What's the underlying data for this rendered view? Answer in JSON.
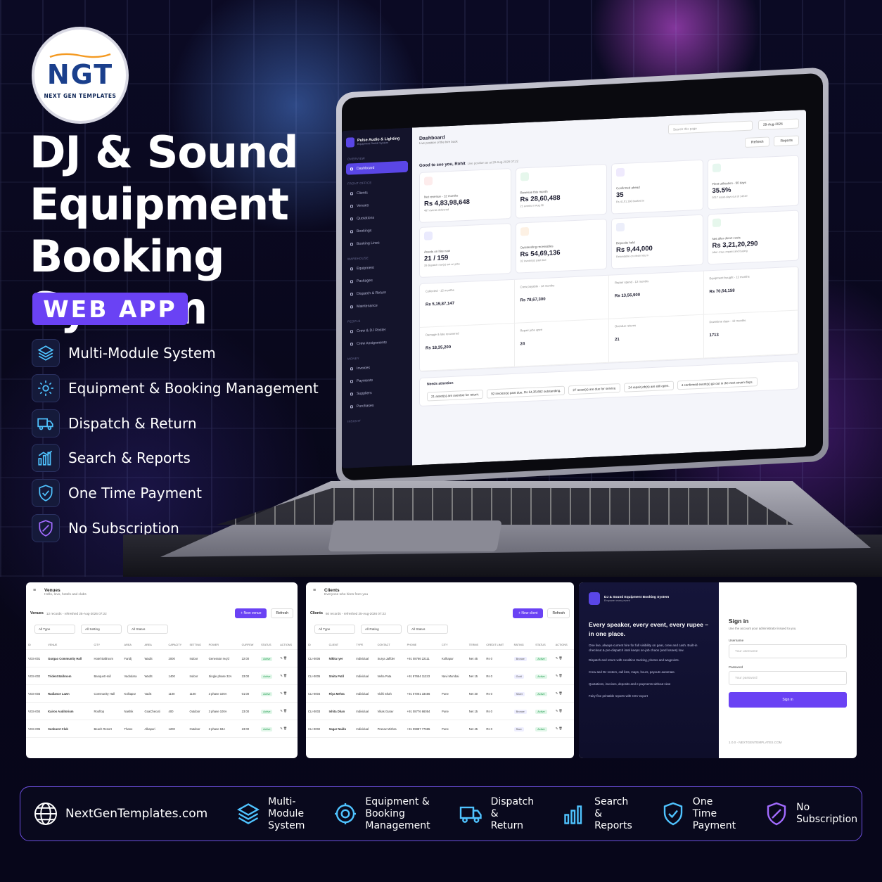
{
  "brand": {
    "logo_mark": "NGT",
    "logo_text": "NEXT GEN TEMPLATES"
  },
  "hero": {
    "title_line1": "DJ & Sound",
    "title_line2": "Equipment",
    "title_line3": "Booking System",
    "badge": "WEB APP"
  },
  "features": [
    {
      "label": "Multi-Module System",
      "icon": "layers-icon"
    },
    {
      "label": "Equipment & Booking Management",
      "icon": "gear-icon"
    },
    {
      "label": "Dispatch & Return",
      "icon": "truck-icon"
    },
    {
      "label": "Search & Reports",
      "icon": "bar-chart-icon"
    },
    {
      "label": "One Time Payment",
      "icon": "shield-check-icon"
    },
    {
      "label": "No Subscription",
      "icon": "shield-no-icon"
    }
  ],
  "dashboard": {
    "sidebar": {
      "brand_name": "Pulse Audio & Lighting",
      "brand_sub": "Equipment Rental System",
      "sections": [
        {
          "title": "OVERVIEW",
          "items": [
            "Dashboard"
          ]
        },
        {
          "title": "FRONT OFFICE",
          "items": [
            "Clients",
            "Venues",
            "Quotations",
            "Bookings",
            "Booking Lines"
          ]
        },
        {
          "title": "WAREHOUSE",
          "items": [
            "Equipment",
            "Packages",
            "Dispatch & Return",
            "Maintenance"
          ]
        },
        {
          "title": "PEOPLE",
          "items": [
            "Crew & DJ Roster",
            "Crew Assignments"
          ]
        },
        {
          "title": "MONEY",
          "items": [
            "Invoices",
            "Payments",
            "Suppliers",
            "Purchases"
          ]
        },
        {
          "title": "INSIGHT",
          "items": []
        }
      ]
    },
    "title": "Dashboard",
    "subtitle": "Live position of the hire book",
    "search_placeholder": "Search this page",
    "date": "29-Aug-2026",
    "refresh": "Refresh",
    "reports": "Reports",
    "greeting": "Good to see you, Rohit",
    "greeting_note": "Live position as at 29-Aug-2026 07:22",
    "kpis": [
      {
        "label": "Net revenue - 12 months",
        "value": "Rs 4,83,98,648",
        "note": "487 events delivered",
        "color": "#fdecec"
      },
      {
        "label": "Revenue this month",
        "value": "Rs 28,60,488",
        "note": "21 events in Aug 26",
        "color": "#e6f7ec"
      },
      {
        "label": "Confirmed ahead",
        "value": "35",
        "note": "Rs 41,01,198 booked in",
        "color": "#efeafd"
      },
      {
        "label": "Fleet utilisation - 90 days",
        "value": "35.5%",
        "note": "5017 asset-days out of 14310",
        "color": "#e6f7ef"
      },
      {
        "label": "Assets on hire now",
        "value": "21 / 159",
        "note": "28 dispatch row(s) out on jobs",
        "color": "#eaeafd"
      },
      {
        "label": "Outstanding receivables",
        "value": "Rs 54,69,136",
        "note": "32 invoice(s) past due",
        "color": "#fdf1e4"
      },
      {
        "label": "Deposits held",
        "value": "Rs 9,44,000",
        "note": "Refundable on clean return",
        "color": "#eceefa"
      },
      {
        "label": "Net after direct costs",
        "value": "Rs 3,21,20,290",
        "note": "After crew, repairs and buying",
        "color": "#e6f7ec"
      }
    ],
    "stats": [
      {
        "label": "Collected - 12 months",
        "value": "Rs 5,19,87,147"
      },
      {
        "label": "Crew payable - 12 months",
        "value": "Rs 78,67,300"
      },
      {
        "label": "Repair spend - 12 months",
        "value": "Rs 13,56,900"
      },
      {
        "label": "Equipment bought - 12 months",
        "value": "Rs 70,54,158"
      },
      {
        "label": "Damage & late recovered",
        "value": "Rs 18,35,200"
      },
      {
        "label": "Repair jobs open",
        "value": "24"
      },
      {
        "label": "Overdue returns",
        "value": "21"
      },
      {
        "label": "Downtime days - 12 months",
        "value": "1713"
      }
    ],
    "attention_title": "Needs attention",
    "attention": [
      "21 asset(s) are overdue for return.",
      "92 invoice(s) past due, Rs 54,35,662 outstanding.",
      "27 asset(s) are due for service.",
      "24 repair job(s) are still open.",
      "4 confirmed event(s) go out in the next seven days."
    ]
  },
  "venues": {
    "title": "Venues",
    "subtitle": "Hello, lovo, hotels and clubs",
    "bar_title": "Venues",
    "bar_note": "12 records - refreshed 25-Aug-2026 07:22",
    "new_label": "+ New venue",
    "refresh": "Refresh",
    "filters": [
      "All Type",
      "All Setting",
      "All Status"
    ],
    "columns": [
      "ID",
      "VENUE",
      "CITY",
      "AREA",
      "AREA",
      "CAPACITY",
      "SETTING",
      "POWER",
      "CURFEW",
      "STATUS",
      "ACTIONS"
    ],
    "rows": [
      [
        "VGS-001",
        "Gurgao Community Hall",
        "Hotel Ballroom",
        "Faridj",
        "WadS",
        "2000",
        "Indoor",
        "Generator req'd",
        "22:00",
        "Active"
      ],
      [
        "VGS-002",
        "Trident Ballroom",
        "Banquet Hall",
        "Vadodara",
        "WadS",
        "1400",
        "Indoor",
        "Single phase 32A",
        "23:00",
        "Active"
      ],
      [
        "VGS-003",
        "Radiance Lawn",
        "Community Hall",
        "Kolkapur",
        "VadS",
        "1100",
        "1100",
        "3 phase 100A",
        "01:00",
        "Active"
      ],
      [
        "VGS-004",
        "Kairos Auditorium",
        "Rooftop",
        "Nashik",
        "GoaChecuti",
        "400",
        "Outdoor",
        "3 phase 100A",
        "23:00",
        "Active"
      ],
      [
        "VGS-005",
        "Sunburst Club",
        "Beach Resort",
        "Thane",
        "Alkapuri",
        "1200",
        "Outdoor",
        "3 phase 63A",
        "23:00",
        "Active"
      ]
    ]
  },
  "clients": {
    "title": "Clients",
    "subtitle": "Everyone who hires from you",
    "bar_title": "Clients",
    "bar_note": "60 records - refreshed 25-Aug-2026 07:22",
    "new_label": "+ New client",
    "refresh": "Refresh",
    "filters": [
      "All Type",
      "All Rating",
      "All Status"
    ],
    "columns": [
      "ID",
      "CLIENT",
      "TYPE",
      "CONTACT",
      "PHONE",
      "CITY",
      "TERMS",
      "CREDIT LIMIT",
      "RATING",
      "STATUS",
      "ACTIONS"
    ],
    "rows": [
      [
        "CLI-0006",
        "Nikita Iyer",
        "Individual",
        "Surya Jaffder",
        "+91 08766 22111",
        "Kolhapur",
        "Net 45",
        "Rs 0",
        "Bronze",
        "Active"
      ],
      [
        "CLI-0005",
        "Smita Patil",
        "Individual",
        "Neha Pata",
        "+91 87654 11223",
        "Navi Mumbai",
        "Net 15",
        "Rs 0",
        "Gold",
        "Active"
      ],
      [
        "CLI-0004",
        "Riya Mehta",
        "Individual",
        "Vidhi Shah",
        "+91 07001 33456",
        "Pune",
        "Net 30",
        "Rs 0",
        "Silver",
        "Active"
      ],
      [
        "CLI-0003",
        "Ishita Dhan",
        "Individual",
        "Vikas Gurav",
        "+91 08776 66054",
        "Pune",
        "Net 15",
        "Rs 0",
        "Bronze",
        "Active"
      ],
      [
        "CLI-0002",
        "Sagar Naidu",
        "Individual",
        "Pranav Mishra",
        "+91 09887 77665",
        "Pune",
        "Net 45",
        "Rs 0",
        "Rare",
        "Active"
      ]
    ]
  },
  "login": {
    "brand_name": "DJ & Sound Equipment Booking System",
    "brand_tag": "Empower every event",
    "headline": "Every speaker, every event, every rupee – in one place.",
    "description": "One live, always-current hire for full visibility on gear, crew and cash. Built-in checkout & pre-dispatch intel keeps on-job chaos (and losses) low.",
    "bullets": [
      "Dispatch and return with condition tracking, photos and waypoints.",
      "Crew and DJ rosters, call lists, maps, hours, payouts automate.",
      "Quotations, invoices, deposits and e-payments without view",
      "Fairy-fine printable reports with CSV export"
    ],
    "title": "Sign in",
    "subtitle": "Use the account your administrator issued to you.",
    "username_label": "Username",
    "username_placeholder": "Your username",
    "password_label": "Password",
    "password_placeholder": "Your password",
    "button": "Sign in",
    "version": "1.0.0 - NEXTGENTEMPLATES.COM"
  },
  "footer": {
    "site": "NextGenTemplates.com",
    "items": [
      {
        "line1": "Multi-Module",
        "line2": "System"
      },
      {
        "line1": "Equipment &",
        "line2": "Booking Management"
      },
      {
        "line1": "Dispatch",
        "line2": "& Return"
      },
      {
        "line1": "Search",
        "line2": "& Reports"
      },
      {
        "line1": "One Time",
        "line2": "Payment"
      },
      {
        "line1": "No",
        "line2": "Subscription"
      }
    ]
  },
  "colors": {
    "accent": "#6a42f4",
    "icon": "#4fc3ff",
    "sidebar": "#14142b"
  }
}
